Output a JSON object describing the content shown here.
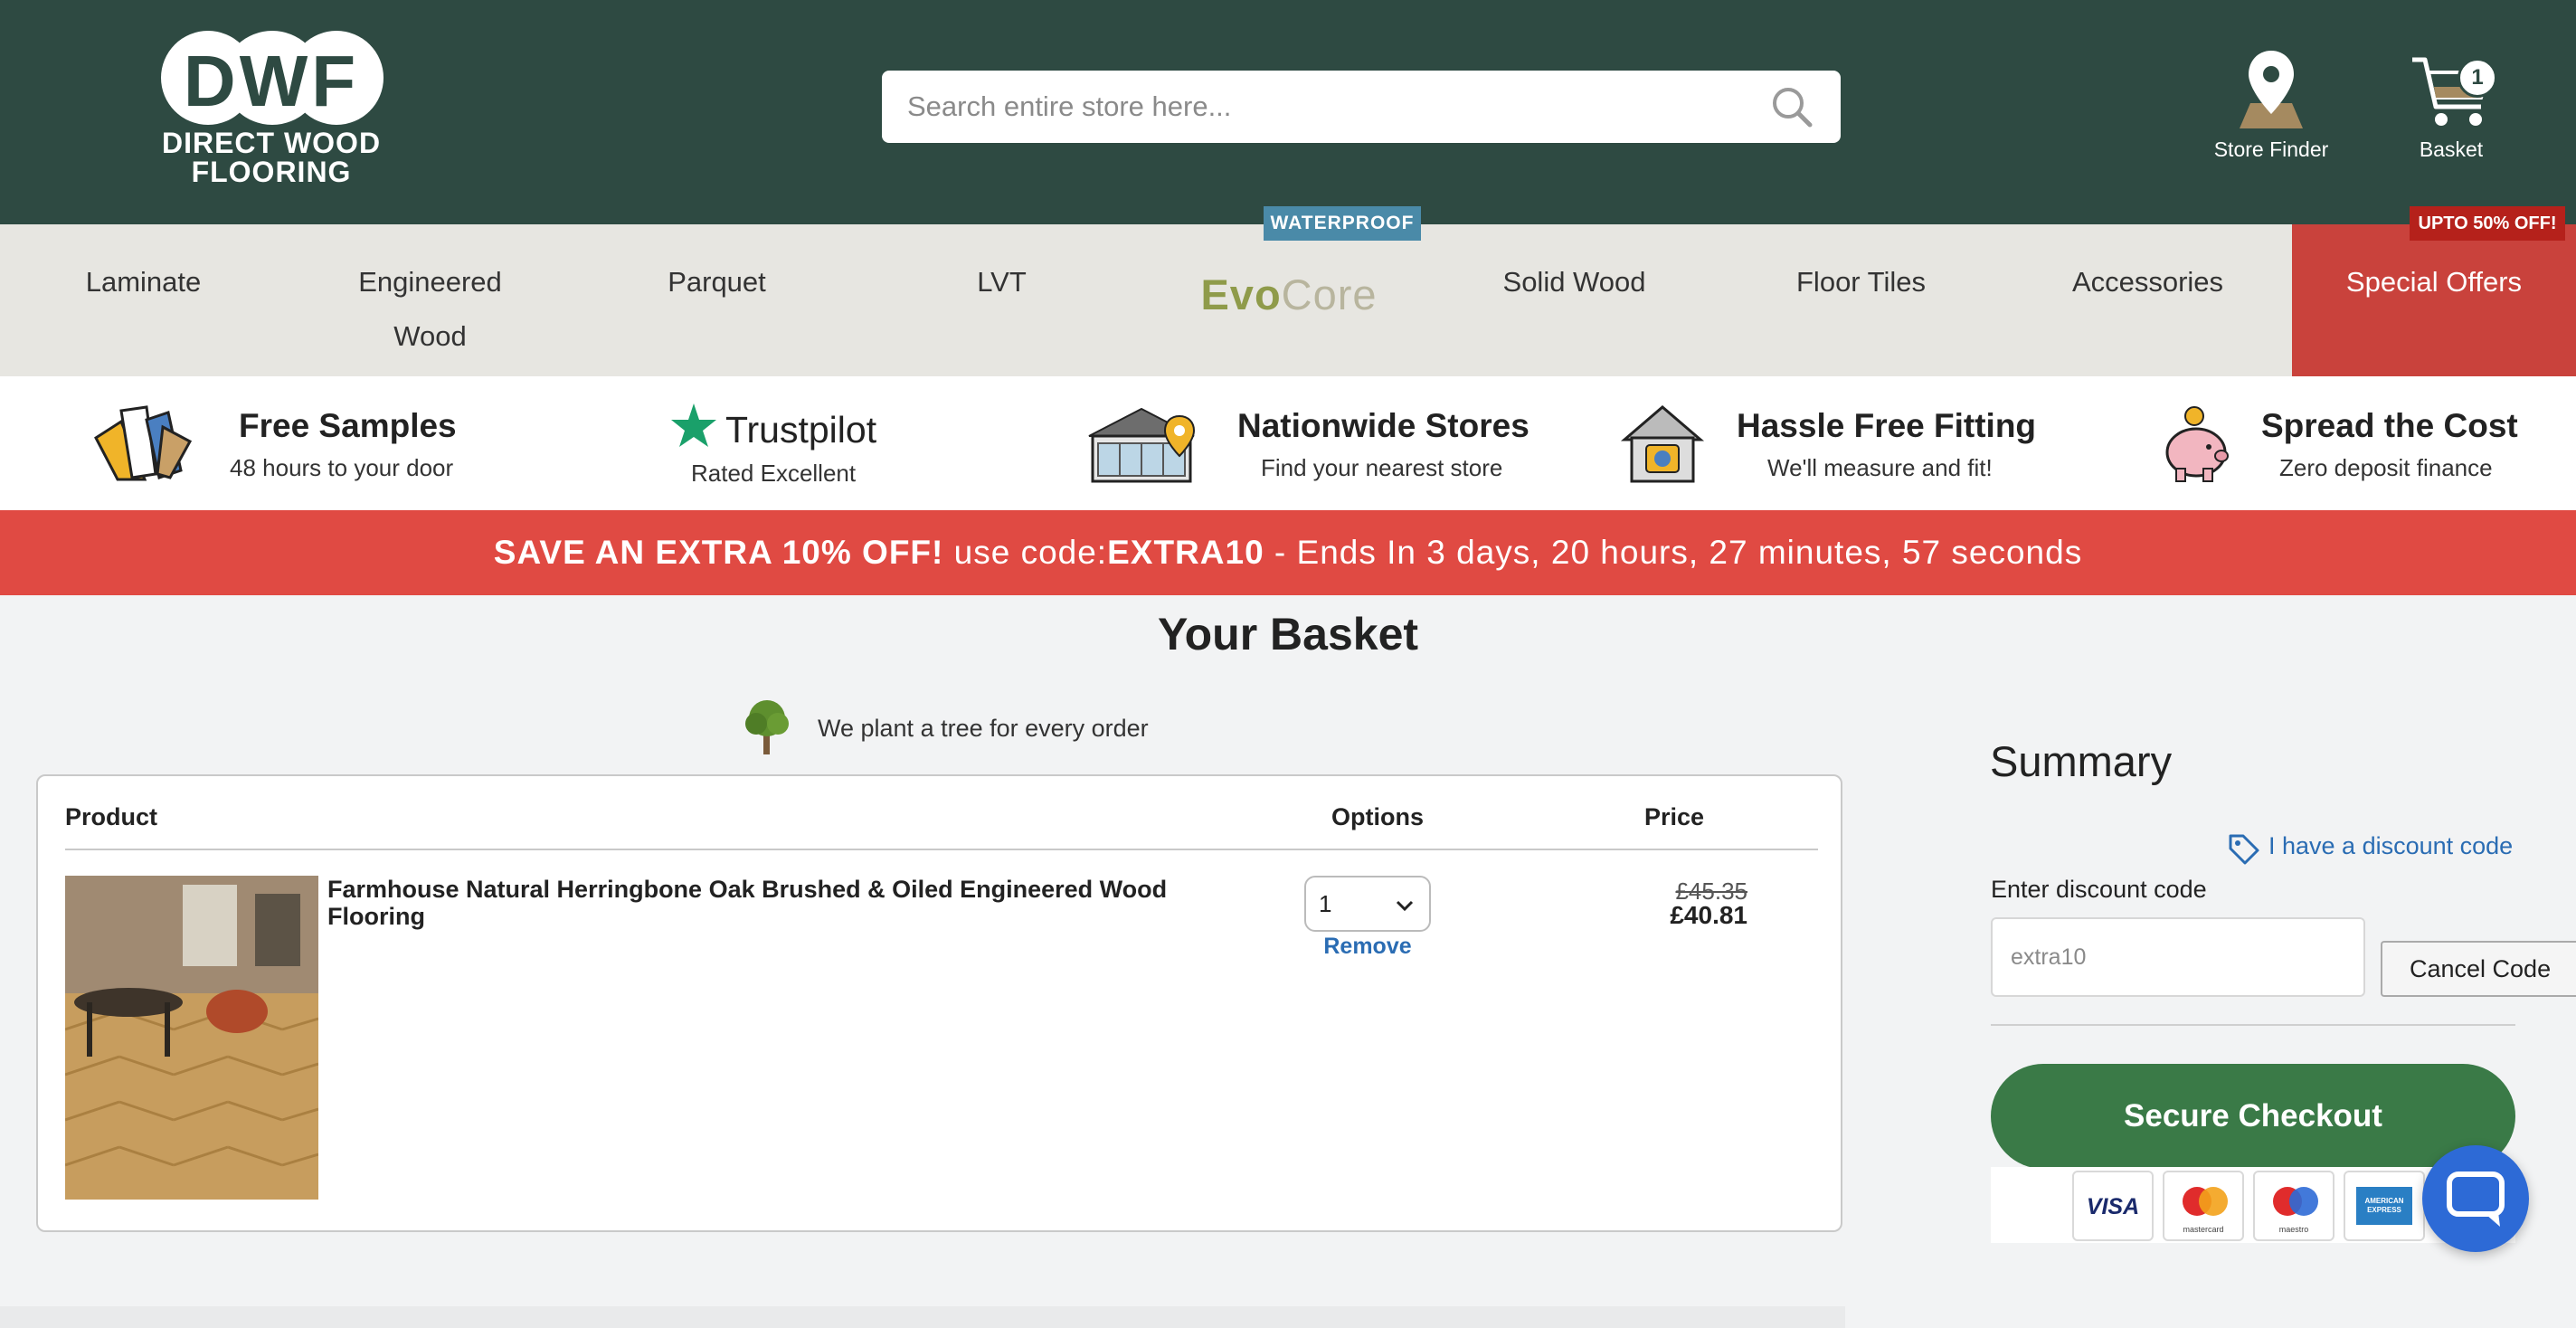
{
  "header": {
    "logo": {
      "letters": "DWF",
      "line1": "DIRECT WOOD",
      "line2": "FLOORING"
    },
    "search": {
      "placeholder": "Search entire store here..."
    },
    "store_finder_label": "Store Finder",
    "basket_label": "Basket",
    "basket_count": "1",
    "colors": {
      "header_bg": "#2e4a42"
    }
  },
  "nav": {
    "items": [
      {
        "label": "Laminate"
      },
      {
        "label": "Engineered Wood"
      },
      {
        "label": "Parquet"
      },
      {
        "label": "LVT"
      },
      {
        "label": "EvoCore",
        "brand_part1": "Evo",
        "brand_part2": "Core",
        "badge": "WATERPROOF"
      },
      {
        "label": "Solid Wood"
      },
      {
        "label": "Floor Tiles"
      },
      {
        "label": "Accessories"
      },
      {
        "label": "Special Offers",
        "badge": "UPTO 50% OFF!"
      }
    ]
  },
  "usps": [
    {
      "icon": "samples-icon",
      "title": "Free Samples",
      "subtitle": "48 hours to your door"
    },
    {
      "icon": "trustpilot-star-icon",
      "title": "Trustpilot",
      "subtitle": "Rated Excellent"
    },
    {
      "icon": "store-icon",
      "title": "Nationwide Stores",
      "subtitle": "Find your nearest store"
    },
    {
      "icon": "fitting-icon",
      "title": "Hassle Free Fitting",
      "subtitle": "We'll measure and fit!"
    },
    {
      "icon": "piggy-bank-icon",
      "title": "Spread the Cost",
      "subtitle": "Zero deposit finance"
    }
  ],
  "promo": {
    "bold": "SAVE AN EXTRA 10% OFF!",
    "middle": " use code:",
    "code": "EXTRA10",
    "tail": " - Ends In 3 days, 20 hours, 27 minutes, 57 seconds",
    "color": "#e04a43"
  },
  "basket": {
    "title": "Your Basket",
    "tree_note": "We plant a tree for every order",
    "columns": {
      "product": "Product",
      "options": "Options",
      "price": "Price"
    },
    "items": [
      {
        "name": "Farmhouse Natural Herringbone Oak Brushed & Oiled Engineered Wood Flooring",
        "quantity": "1",
        "remove_label": "Remove",
        "price_old": "£45.35",
        "price_new": "£40.81"
      }
    ]
  },
  "summary": {
    "title": "Summary",
    "discount_link": "I have a discount code",
    "discount_label": "Enter discount code",
    "discount_value": "extra10",
    "cancel_label": "Cancel Code",
    "checkout_label": "Secure Checkout",
    "payment_methods": [
      "VISA",
      "mastercard",
      "maestro",
      "AMERICAN EXPRESS"
    ],
    "checkout_color": "#3a7a47"
  }
}
